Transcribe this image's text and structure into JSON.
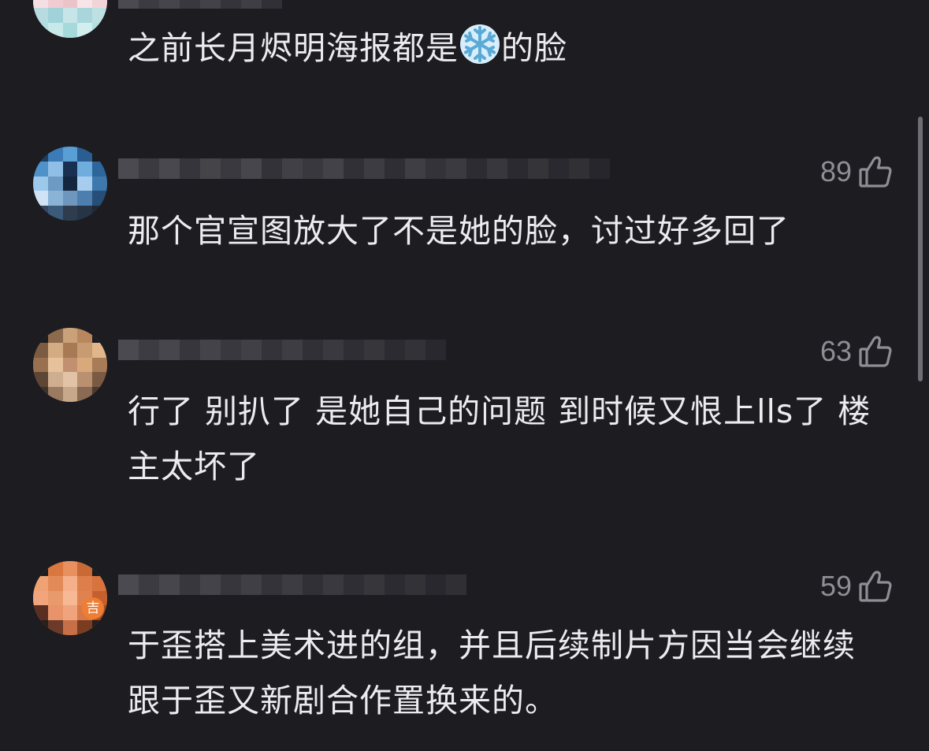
{
  "comments": [
    {
      "likes": "",
      "text": "之前长月烬明海报都是",
      "text_after_emoji": "的脸",
      "emoji": "snowflake-emoji"
    },
    {
      "likes": "89",
      "text": "那个官宣图放大了不是她的脸，讨过好多回了"
    },
    {
      "likes": "63",
      "text": "行了 别扒了 是她自己的问题 到时候又恨上lls了 楼主太坏了"
    },
    {
      "likes": "59",
      "text": "于歪搭上美术进的组，并且后续制片方因当会继续跟于歪又新剧合作置换来的。"
    }
  ],
  "icons": {
    "like": "thumbs-up-outline-icon"
  },
  "colors": {
    "background": "#1c1c21",
    "text": "#ececef",
    "muted": "#8e8e94"
  }
}
